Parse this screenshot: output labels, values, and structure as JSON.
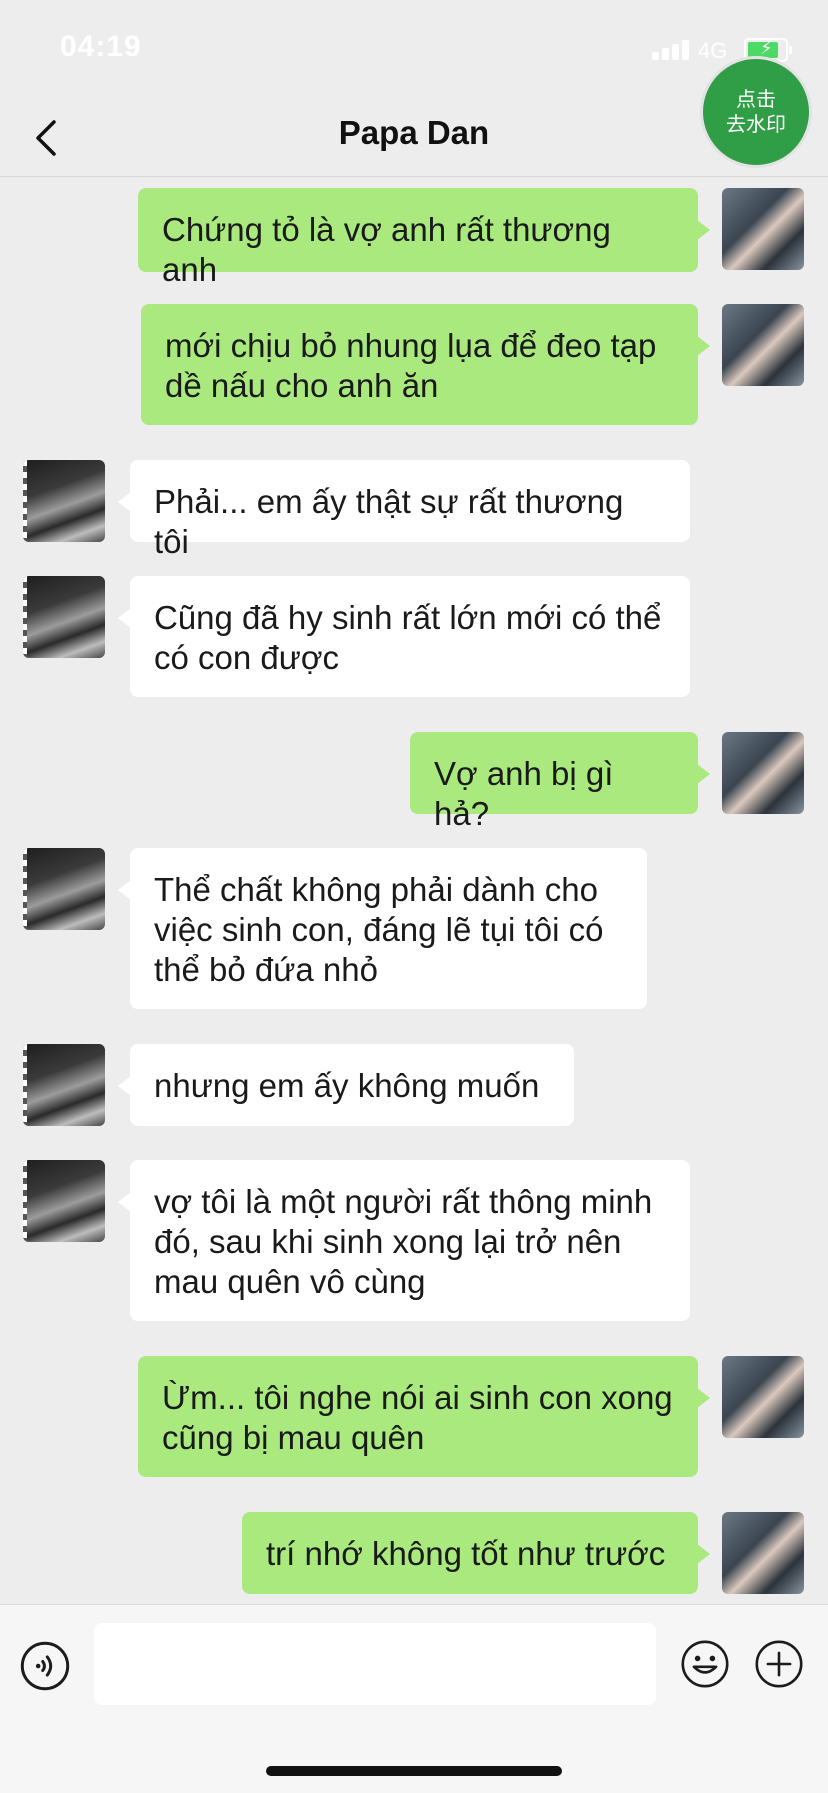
{
  "status_bar": {
    "time": "04:19",
    "network": "4G"
  },
  "nav": {
    "back_icon": "chevron-left-icon",
    "title": "Papa Dan"
  },
  "watermark_button": {
    "label": "点击\n去水印"
  },
  "messages": [
    {
      "side": "me",
      "text": "Chứng tỏ là vợ anh rất thương anh"
    },
    {
      "side": "me",
      "text": "mới chịu bỏ nhung lụa để đeo tạp dề nấu cho anh ăn"
    },
    {
      "side": "other",
      "text": "Phải... em ấy thật sự rất thương tôi"
    },
    {
      "side": "other",
      "text": "Cũng đã hy sinh rất lớn mới có thể có con được"
    },
    {
      "side": "me",
      "text": "Vợ anh bị gì hả?"
    },
    {
      "side": "other",
      "text": "Thể chất không phải dành cho việc sinh con, đáng lẽ tụi tôi có thể bỏ đứa nhỏ"
    },
    {
      "side": "other",
      "text": "nhưng em ấy không muốn"
    },
    {
      "side": "other",
      "text": "vợ tôi là một người rất thông minh đó, sau khi sinh xong lại trở nên mau quên vô cùng"
    },
    {
      "side": "me",
      "text": "Ừm... tôi nghe nói ai sinh con xong cũng bị mau quên"
    },
    {
      "side": "me",
      "text": "trí nhớ không tốt như trước"
    }
  ],
  "input_bar": {
    "voice_icon": "voice-icon",
    "input_value": "",
    "emoji_icon": "emoji-icon",
    "plus_icon": "plus-icon"
  }
}
